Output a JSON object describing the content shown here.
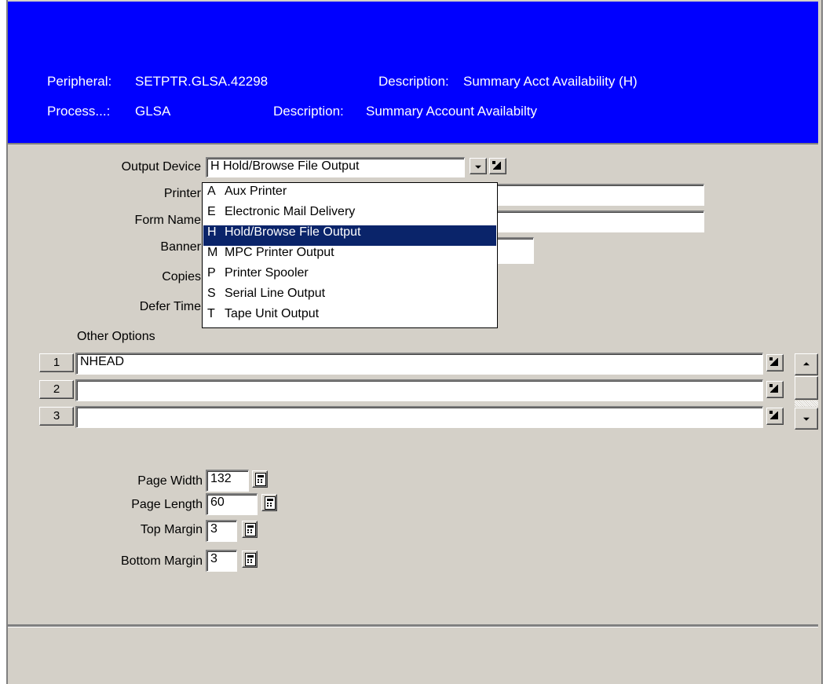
{
  "header": {
    "peripheral_label": "Peripheral:",
    "peripheral_value": "SETPTR.GLSA.42298",
    "peripheral_desc_label": "Description:",
    "peripheral_desc_value": "Summary Acct Availability (H)",
    "process_label": "Process...:",
    "process_value": "GLSA",
    "process_desc_label": "Description:",
    "process_desc_value": "Summary Account Availabilty"
  },
  "form": {
    "output_device_label": "Output Device",
    "output_device_value": "H Hold/Browse File Output",
    "printer_label": "Printer",
    "form_name_label": "Form Name",
    "banner_label": "Banner",
    "copies_label": "Copies",
    "defer_time_label": "Defer Time",
    "other_options_label": "Other Options",
    "options": [
      {
        "num": "1",
        "value": "NHEAD"
      },
      {
        "num": "2",
        "value": ""
      },
      {
        "num": "3",
        "value": ""
      }
    ],
    "page_width_label": "Page Width",
    "page_width_value": "132",
    "page_length_label": "Page Length",
    "page_length_value": "60",
    "top_margin_label": "Top Margin",
    "top_margin_value": "3",
    "bottom_margin_label": "Bottom Margin",
    "bottom_margin_value": "3"
  },
  "dropdown": {
    "items": [
      {
        "code": "A",
        "label": "Aux Printer"
      },
      {
        "code": "E",
        "label": "Electronic Mail Delivery"
      },
      {
        "code": "H",
        "label": "Hold/Browse File Output"
      },
      {
        "code": "M",
        "label": "MPC Printer Output"
      },
      {
        "code": "P",
        "label": "Printer Spooler"
      },
      {
        "code": "S",
        "label": "Serial Line Output"
      },
      {
        "code": "T",
        "label": "Tape Unit Output"
      }
    ],
    "selected": "H"
  },
  "colors": {
    "header_bg": "#0000ff",
    "selection_bg": "#0a246a",
    "window_bg": "#d4d0c8"
  }
}
